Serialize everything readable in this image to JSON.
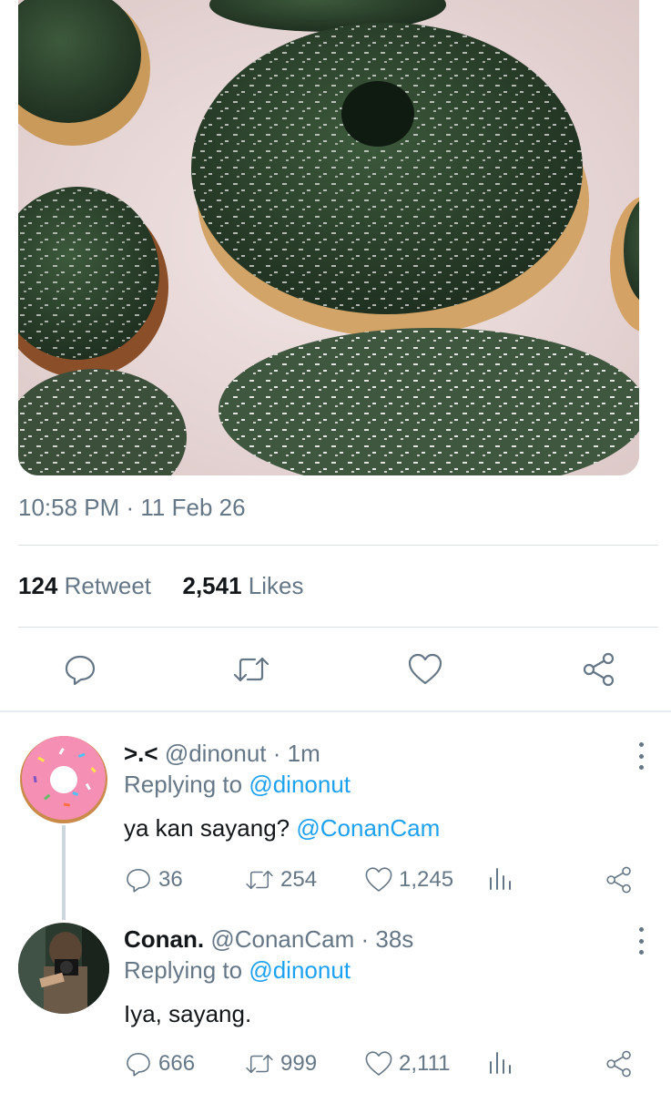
{
  "tweet": {
    "timestamp": "10:58 PM · 11 Feb 26",
    "retweet_count": "124",
    "retweet_label": "Retweet",
    "likes_count": "2,541",
    "likes_label": "Likes"
  },
  "replies": [
    {
      "display_name": ">.<",
      "handle": "@dinonut",
      "time": "· 1m",
      "replying_label": "Replying to",
      "replying_to": "@dinonut",
      "text": "ya kan sayang?",
      "mention": "@ConanCam",
      "reply_count": "36",
      "retweet_count": "254",
      "like_count": "1,245"
    },
    {
      "display_name": "Conan.",
      "handle": "@ConanCam",
      "time": "· 38s",
      "replying_label": "Replying to",
      "replying_to": "@dinonut",
      "text": "Iya, sayang.",
      "mention": "",
      "reply_count": "666",
      "retweet_count": "999",
      "like_count": "2,111"
    }
  ],
  "colors": {
    "link": "#1da1f2",
    "secondary_text": "#657786",
    "primary_text": "#14171a",
    "donut_glaze": "#2a3f2a"
  }
}
